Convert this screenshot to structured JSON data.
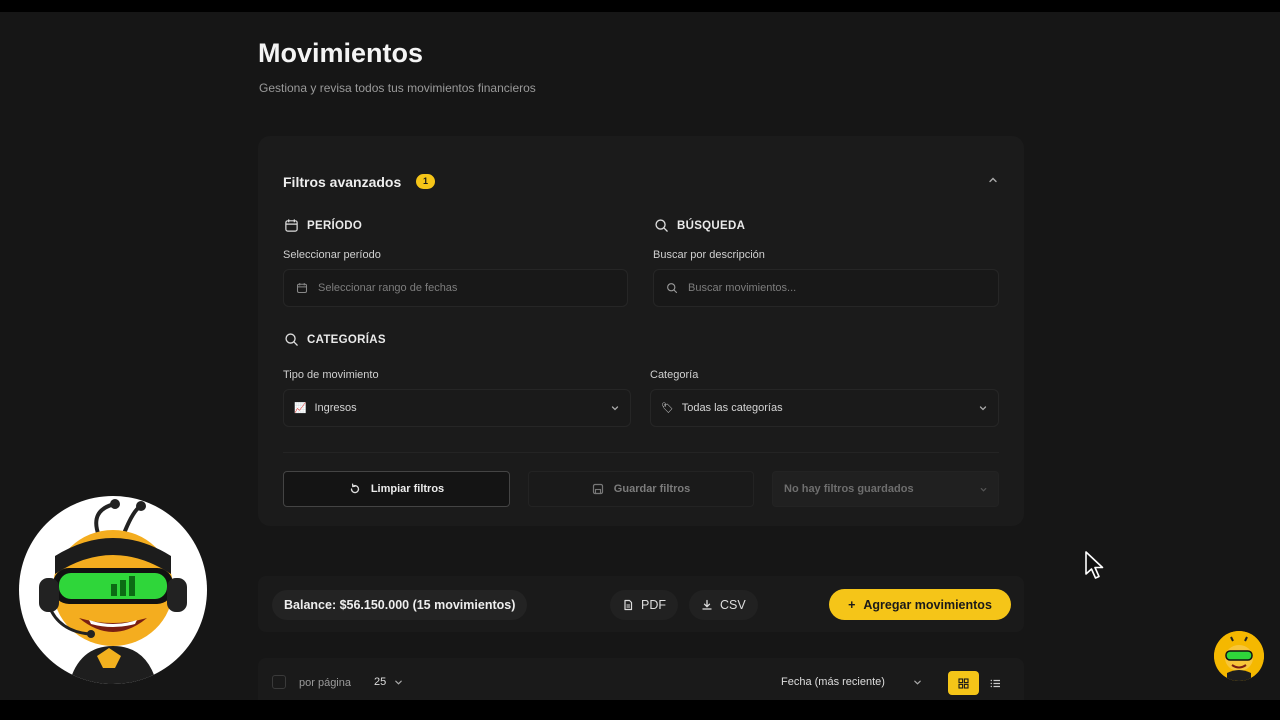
{
  "page": {
    "title": "Movimientos",
    "subtitle": "Gestiona y revisa todos tus movimientos financieros"
  },
  "filters": {
    "title": "Filtros avanzados",
    "badge_count": "1",
    "period": {
      "heading": "PERÍODO",
      "label": "Seleccionar período",
      "placeholder": "Seleccionar rango de fechas"
    },
    "search": {
      "heading": "BÚSQUEDA",
      "label": "Buscar por descripción",
      "placeholder": "Buscar movimientos..."
    },
    "categories": {
      "heading": "CATEGORÍAS",
      "type_label": "Tipo de movimiento",
      "type_value": "Ingresos",
      "category_label": "Categoría",
      "category_value": "Todas las categorías"
    },
    "actions": {
      "clear": "Limpiar filtros",
      "save": "Guardar filtros",
      "saved_placeholder": "No hay filtros guardados"
    }
  },
  "toolbar": {
    "balance": "Balance: $56.150.000 (15 movimientos)",
    "pdf": "PDF",
    "csv": "CSV",
    "add": "Agregar movimientos"
  },
  "list": {
    "per_page_label": "por página",
    "per_page_value": "25",
    "sort_value": "Fecha (más reciente)"
  },
  "icons": {
    "calendar": "calendar-icon",
    "search": "search-icon",
    "chevron": "chevron-down-icon",
    "refresh": "refresh-icon",
    "save": "save-icon",
    "file": "file-icon",
    "download": "download-icon",
    "plus": "plus-icon",
    "grid": "grid-icon",
    "list": "list-icon"
  },
  "colors": {
    "accent": "#f5c518",
    "background": "#161616",
    "panel": "#1b1b1b"
  }
}
